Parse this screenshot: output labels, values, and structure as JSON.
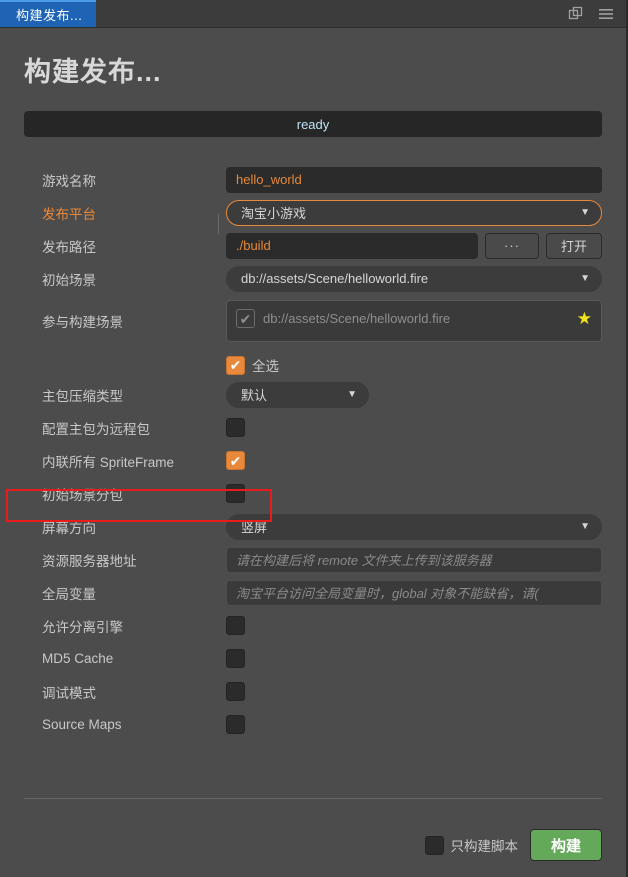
{
  "tabbar": {
    "tab_label": "构建发布...",
    "icons": [
      {
        "name": "popout-panel-icon"
      },
      {
        "name": "hamburger-menu-icon"
      }
    ]
  },
  "page": {
    "title": "构建发布...",
    "status": "ready"
  },
  "colors": {
    "accent_orange": "#e8883a",
    "tab_blue": "#1f64b4",
    "build_green": "#64a85a",
    "highlight_red": "#e81c1c",
    "star_yellow": "#f2e41c",
    "status_text": "#bfe3f5",
    "panel_bg": "#4c4c4c"
  },
  "form": {
    "game_name": {
      "label": "游戏名称",
      "value": "hello_world"
    },
    "platform": {
      "label": "发布平台",
      "value": "淘宝小游戏"
    },
    "build_path": {
      "label": "发布路径",
      "value": "./build",
      "browse_label": "···",
      "open_label": "打开"
    },
    "start_scene": {
      "label": "初始场景",
      "value": "db://assets/Scene/helloworld.fire"
    },
    "included_scenes": {
      "label": "参与构建场景",
      "items": [
        {
          "name": "db://assets/Scene/helloworld.fire",
          "checked": true,
          "starred": true
        }
      ],
      "select_all_label": "全选",
      "select_all_checked": true
    },
    "compression": {
      "label": "主包压缩类型",
      "value": "默认"
    },
    "main_bundle_remote": {
      "label": "配置主包为远程包",
      "checked": false
    },
    "inline_spriteframe": {
      "label": "内联所有 SpriteFrame",
      "checked": true
    },
    "start_scene_bundle": {
      "label": "初始场景分包",
      "checked": false
    },
    "orientation": {
      "label": "屏幕方向",
      "value": "竖屏"
    },
    "resource_server": {
      "label": "资源服务器地址",
      "placeholder": "请在构建后将 remote 文件夹上传到该服务器"
    },
    "global_var": {
      "label": "全局变量",
      "placeholder": "淘宝平台访问全局变量时，global 对象不能缺省，请("
    },
    "separate_engine": {
      "label": "允许分离引擎",
      "checked": false,
      "highlighted": true
    },
    "md5_cache": {
      "label": "MD5 Cache",
      "checked": false
    },
    "debug_mode": {
      "label": "调试模式",
      "checked": false
    },
    "source_maps": {
      "label": "Source Maps",
      "checked": false
    }
  },
  "footer": {
    "script_only_label": "只构建脚本",
    "script_only_checked": false,
    "build_label": "构建"
  }
}
